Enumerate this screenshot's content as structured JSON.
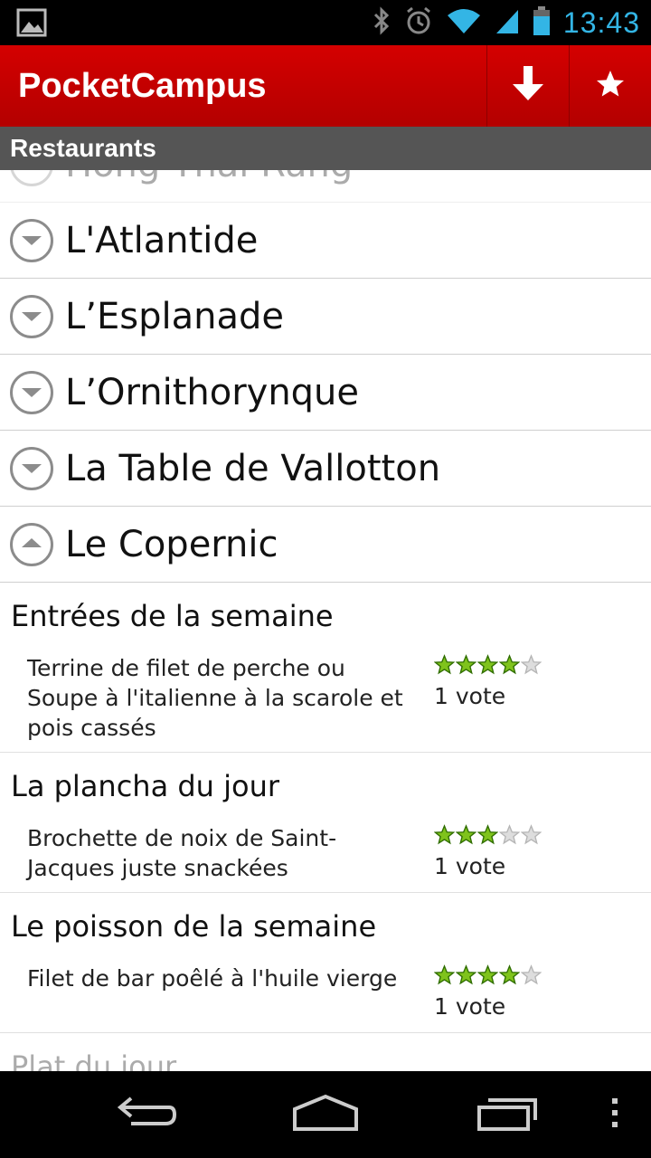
{
  "status_bar": {
    "time": "13:43",
    "icons": [
      "picture-notification-icon",
      "bluetooth-icon",
      "alarm-icon",
      "wifi-icon",
      "signal-icon",
      "battery-icon"
    ]
  },
  "action_bar": {
    "title": "PocketCampus",
    "download_icon": "download-arrow-icon",
    "favorite_icon": "star-icon",
    "color": "#c80000"
  },
  "section": {
    "label": "Restaurants"
  },
  "restaurants": [
    {
      "name": "Hong Thaï Rung",
      "expanded": false,
      "partially_visible": true
    },
    {
      "name": "L'Atlantide",
      "expanded": false
    },
    {
      "name": "L’Esplanade",
      "expanded": false
    },
    {
      "name": "L’Ornithorynque",
      "expanded": false
    },
    {
      "name": "La Table de Vallotton",
      "expanded": false
    },
    {
      "name": "Le Copernic",
      "expanded": true
    }
  ],
  "dishes": [
    {
      "category": "Entrées de la semaine",
      "description": "Terrine de filet de perche ou Soupe à l'italienne à la scarole et pois cassés",
      "rating": 4,
      "max_rating": 5,
      "votes": "1 vote"
    },
    {
      "category": "La plancha du jour",
      "description": "Brochette de noix de Saint-Jacques juste snackées",
      "rating": 3,
      "max_rating": 5,
      "votes": "1 vote"
    },
    {
      "category": "Le poisson de la semaine",
      "description": "Filet de bar poêlé à l'huile vierge",
      "rating": 4,
      "max_rating": 5,
      "votes": "1 vote"
    },
    {
      "category": "Plat du jour",
      "partially_visible": true
    }
  ],
  "nav_bar": {
    "back_icon": "back-icon",
    "home_icon": "home-icon",
    "recents_icon": "recent-apps-icon",
    "menu_icon": "overflow-menu-icon"
  },
  "colors": {
    "status_accent": "#33b5e5",
    "star_filled": "#7fc31c",
    "star_empty": "#dddddd",
    "header_gray": "#555555"
  }
}
